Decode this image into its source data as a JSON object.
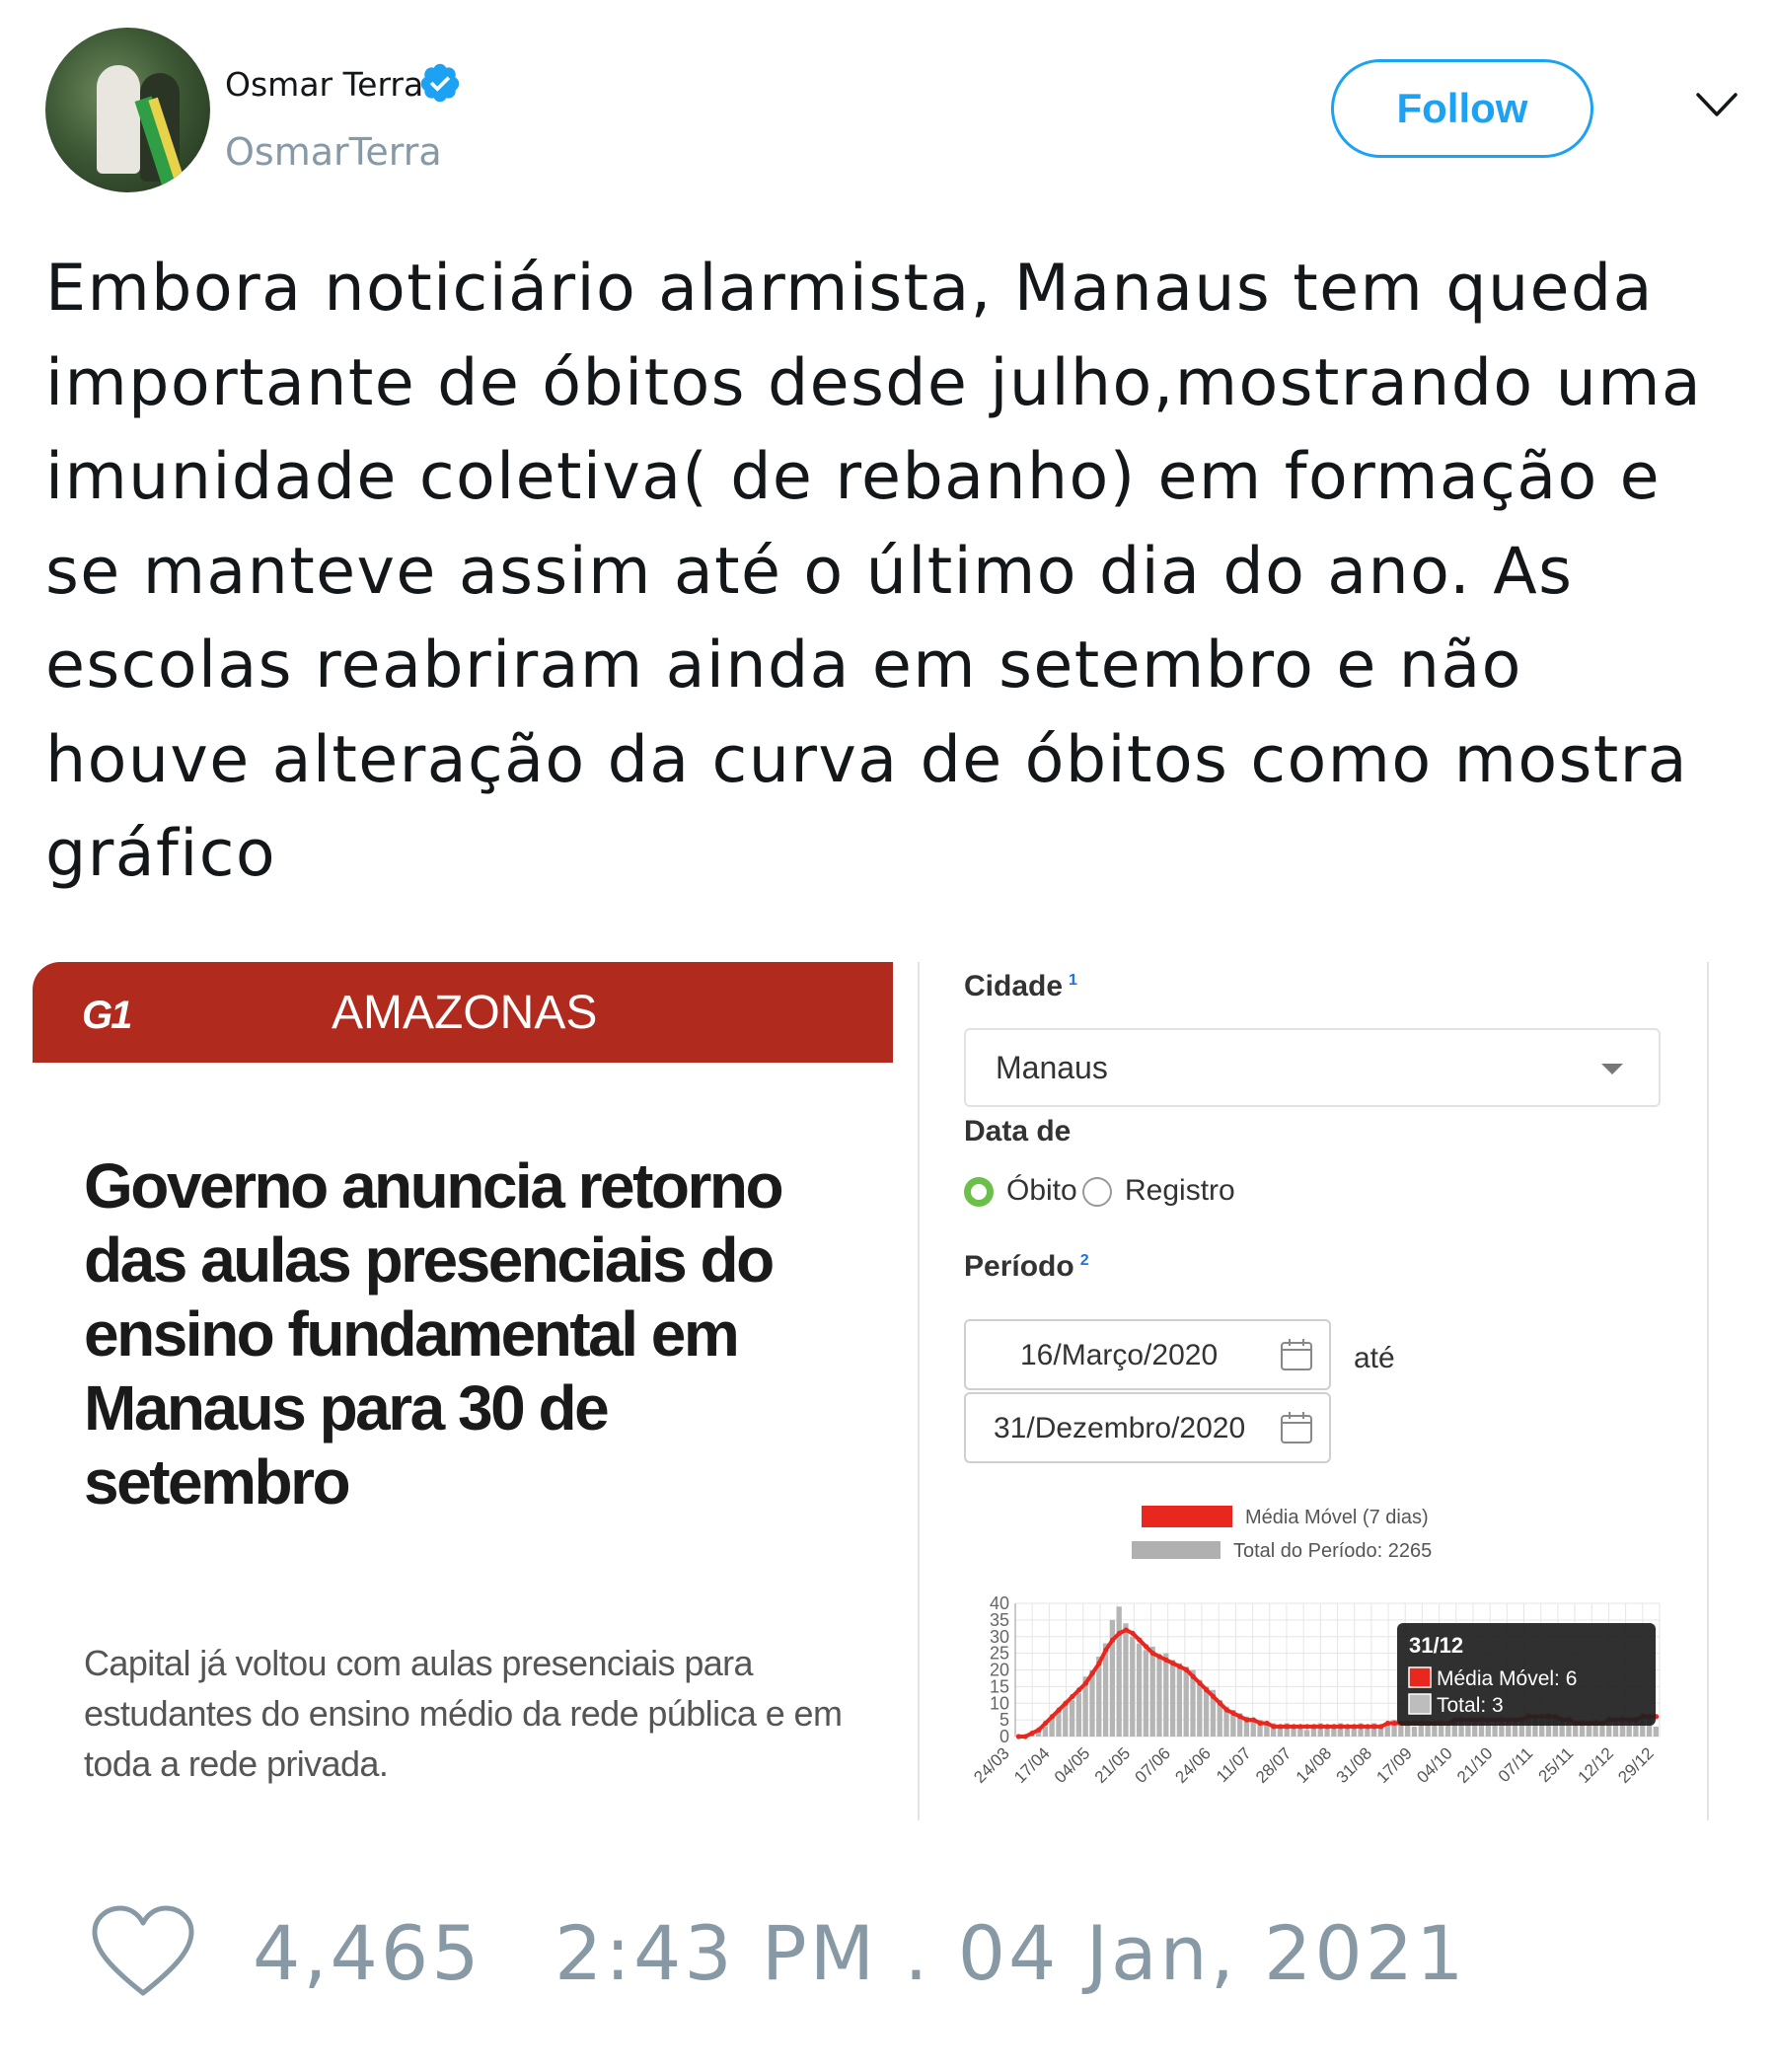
{
  "author": {
    "name": "Osmar Terra",
    "handle": "OsmarTerra",
    "verified": true,
    "verified_icon": "verified-badge-icon"
  },
  "follow_label": "Follow",
  "tweet_text": "Embora noticiário alarmista, Manaus tem queda importante de óbitos desde julho,mostrando uma imunidade coletiva( de rebanho) em formação e se manteve assim até o último dia do ano. As escolas reabriram ainda em setembro e não houve alteração da curva de óbitos como mostra gráfico",
  "embed": {
    "g1": {
      "logo": "G1",
      "section": "AMAZONAS",
      "headline": "Governo anuncia retorno das aulas presenciais do ensino fundamental em Manaus para 30 de setembro",
      "subheadline": "Capital já voltou com aulas presenciais para estudantes do ensino médio da rede pública e em toda a rede privada.",
      "accent_color": "#b02a1e"
    },
    "panel": {
      "cidade_label": "Cidade",
      "cidade_sup": "1",
      "cidade_value": "Manaus",
      "data_de_label": "Data de",
      "radio_obito": "Óbito",
      "radio_registro": "Registro",
      "selected_radio": "Óbito",
      "periodo_label": "Período",
      "periodo_sup": "2",
      "date_from": "16/Março/2020",
      "date_to": "31/Dezembro/2020",
      "ate_label": "até"
    }
  },
  "chart_data": {
    "type": "bar",
    "legend": [
      {
        "name": "Média Móvel (7 dias)",
        "color": "#e8271f"
      },
      {
        "name": "Total do Período: 2265",
        "color": "#b0b0b0"
      }
    ],
    "y_ticks": [
      "40",
      "35",
      "30",
      "25",
      "20",
      "15",
      "10",
      "5",
      "0"
    ],
    "ylim": [
      0,
      40
    ],
    "x_ticks": [
      "24/03",
      "17/04",
      "04/05",
      "21/05",
      "07/06",
      "24/06",
      "11/07",
      "28/07",
      "14/08",
      "31/08",
      "17/09",
      "04/10",
      "21/10",
      "07/11",
      "25/11",
      "12/12",
      "29/12"
    ],
    "series": [
      {
        "name": "Média Móvel (7 dias)",
        "kind": "line",
        "values": [
          0,
          0,
          1,
          2,
          4,
          6,
          8,
          10,
          12,
          14,
          16,
          19,
          22,
          26,
          29,
          31,
          32,
          31,
          29,
          27,
          25,
          24,
          23,
          22,
          21,
          20,
          18,
          16,
          14,
          12,
          10,
          8,
          7,
          6,
          5,
          5,
          4,
          4,
          3,
          3,
          3,
          3,
          3,
          3,
          3,
          3,
          3,
          3,
          3,
          3,
          3,
          3,
          3,
          3,
          3,
          4,
          4,
          4,
          4,
          4,
          4,
          4,
          4,
          4,
          4,
          5,
          5,
          5,
          5,
          5,
          5,
          5,
          5,
          5,
          5,
          5,
          6,
          6,
          6,
          6,
          6,
          5,
          5,
          4,
          4,
          4,
          4,
          4,
          5,
          5,
          5,
          5,
          5,
          6,
          6,
          6
        ]
      },
      {
        "name": "Total",
        "kind": "bar",
        "values": [
          0,
          0,
          1,
          2,
          3,
          6,
          8,
          10,
          11,
          13,
          18,
          20,
          24,
          28,
          35,
          39,
          34,
          30,
          28,
          26,
          27,
          24,
          25,
          23,
          22,
          21,
          20,
          17,
          15,
          14,
          11,
          9,
          8,
          7,
          6,
          5,
          5,
          4,
          4,
          3,
          4,
          3,
          3,
          2,
          3,
          4,
          3,
          3,
          4,
          3,
          3,
          4,
          3,
          4,
          3,
          4,
          5,
          4,
          4,
          3,
          5,
          4,
          4,
          5,
          4,
          5,
          6,
          5,
          5,
          6,
          5,
          4,
          6,
          5,
          5,
          6,
          7,
          6,
          5,
          7,
          6,
          5,
          6,
          4,
          5,
          4,
          5,
          4,
          6,
          5,
          6,
          5,
          6,
          7,
          6,
          3
        ]
      }
    ],
    "tooltip": {
      "title": "31/12",
      "line1": "Média Móvel: 6",
      "line2": "Total: 3"
    }
  },
  "footer": {
    "like_icon": "heart-icon",
    "likes": "4,465",
    "timestamp": "2:43 PM . 04 Jan, 2021"
  }
}
